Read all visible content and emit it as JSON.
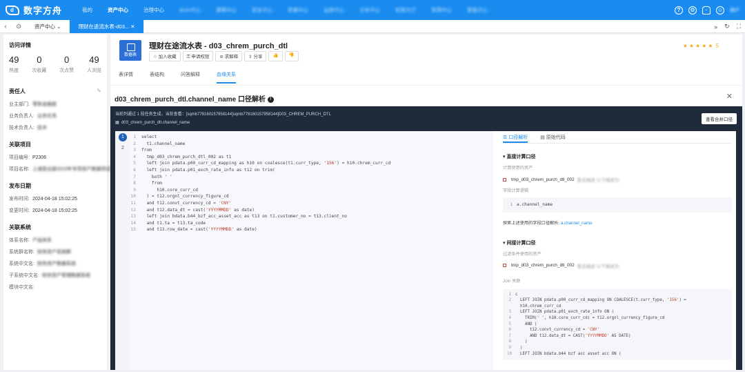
{
  "topnav": {
    "brand": "数字方舟",
    "items": [
      "我的",
      "资产中心",
      "治理中心",
      "BI/AI中心",
      "建模中心",
      "研发中心",
      "质量中心",
      "运维中心",
      "分析中心",
      "权限大厅",
      "管理中心",
      "智能中心"
    ],
    "active_index": 1,
    "icons": [
      "help-icon",
      "settings-icon",
      "bell-icon",
      "user-icon"
    ],
    "user": "用户"
  },
  "tabbar": {
    "tabs": [
      "资产中心",
      "理财在途流水表-d03..."
    ],
    "active_index": 1
  },
  "visit": {
    "title": "访问详情",
    "stats": [
      {
        "value": "49",
        "label": "热度"
      },
      {
        "value": "0",
        "label": "次收藏"
      },
      {
        "value": "0",
        "label": "次点赞"
      },
      {
        "value": "49",
        "label": "人浏览"
      }
    ]
  },
  "owner": {
    "title": "责任人",
    "rows": [
      {
        "label": "业主部门:",
        "value": "零售金融部"
      },
      {
        "label": "业务负责人:",
        "value": "业务负责"
      },
      {
        "label": "技术负责人:",
        "value": "技术"
      }
    ]
  },
  "project": {
    "title": "关联项目",
    "rows": [
      {
        "label": "项目编号:",
        "value": "P2306"
      },
      {
        "label": "项目名称:",
        "value": "上海营业部2023年专项资产数据项目"
      }
    ]
  },
  "publish": {
    "title": "发布日期",
    "rows": [
      {
        "label": "发布时间:",
        "value": "2024-04-18 15:02:25"
      },
      {
        "label": "变更时间:",
        "value": "2024-04-18 15:02:25"
      }
    ]
  },
  "system": {
    "title": "关联系统",
    "rows": [
      {
        "label": "体系名称:",
        "value": "产品体系"
      },
      {
        "label": "系统群名称:",
        "value": "财务资产系统群"
      },
      {
        "label": "系统中文名:",
        "value": "财务资产数据系统"
      },
      {
        "label": "子系统中文名:",
        "value": "财务资产管理数据系统"
      },
      {
        "label": "模块中文名:",
        "value": ""
      }
    ]
  },
  "asset": {
    "icon_label": "数据表",
    "title": "理财在途流水表 - d03_chrem_purch_dtl",
    "actions": [
      "加入收藏",
      "申请权限",
      "求解释",
      "分享",
      "",
      ""
    ],
    "rating": "5",
    "tabs": [
      "表详情",
      "表结构",
      "问答解释",
      "血缘关系"
    ],
    "active_tab": 3
  },
  "panel": {
    "title": "d03_chrem_purch_dtl.channel_name 口径解析",
    "header_line1": "当前列通过 1 段任务生成，当前查看：[sqmb778160157958144]sqmb778160157958144]D03_CHREM_PURCH_DTL",
    "header_line2": "d03_chrem_purch_dtl.channel_name",
    "merge_button": "查看合并口径"
  },
  "gutter": [
    "1",
    "2"
  ],
  "code_lines": [
    {
      "n": "1",
      "t": "select"
    },
    {
      "n": "2",
      "t": "  t1.channel_name"
    },
    {
      "n": "3",
      "t": "from"
    },
    {
      "n": "4",
      "t": "  tmp_d03_chrem_purch_dtl_002 as t1"
    },
    {
      "n": "5",
      "t": "  left join pdata.p00_curr_cd_mapping as h10 on coalesce(t1.curr_type, '156') = h10.chrem_curr_cd"
    },
    {
      "n": "6",
      "t": "  left join pdata.p01_exch_rate_info as t12 on trim("
    },
    {
      "n": "7",
      "t": "    both ' '"
    },
    {
      "n": "8",
      "t": "    from"
    },
    {
      "n": "9",
      "t": "      h10.core_curr_cd"
    },
    {
      "n": "10",
      "t": "  ) = t12.orgnl_currency_figure_cd"
    },
    {
      "n": "11",
      "t": "  and t12.convt_currency_cd = 'CNY'"
    },
    {
      "n": "12",
      "t": "  and t12.data_dt = cast('YYYYMMDD' as date)"
    },
    {
      "n": "13",
      "t": "  left join bdata.b44_bzf_acc_asset_acc as t13 on t1.customer_no = t13.client_no"
    },
    {
      "n": "14",
      "t": "  and t1.ta = t13.ta_code"
    },
    {
      "n": "15",
      "t": "  and t13.row_date = cast('YYYYMMDD' as date)"
    }
  ],
  "right": {
    "tabs": [
      "口径解析",
      "原始代码"
    ],
    "active_tab": 0,
    "direct": {
      "title": "直接计算口径",
      "sub": "计算使用的资产",
      "item": "tmp_d03_chrem_purch_dtl_002",
      "item_note": "暂无描述  以下描述为:",
      "logic_label": "字段计算逻辑",
      "logic_code": [
        {
          "n": "1",
          "t": "a.channel_name"
        }
      ],
      "explore_text": "探索上述使用的字段口径解析:",
      "explore_link": "a.channel_name"
    },
    "indirect": {
      "title": "间接计算口径",
      "sub": "过滤条件使用的资产",
      "item": "tmp_d03_chrem_purch_dtl_002",
      "item_note": "暂无描述  以下描述为:",
      "join_label": "Join 关联",
      "join_code": [
        {
          "n": "1",
          "t": "c"
        },
        {
          "n": "2",
          "t": "  LEFT JOIN pdata.p00_curr_cd_mapping ON COALESCE(t.curr_type, '156') ="
        },
        {
          "n": "",
          "t": "  h10.chrem_curr_cd"
        },
        {
          "n": "3",
          "t": "  LEFT JOIN pdata.p01_exch_rate_info ON ("
        },
        {
          "n": "4",
          "t": "    TRIM(' ', h10.core_curr_cd) = t12.orgnl_currency_figure_cd"
        },
        {
          "n": "5",
          "t": "    AND ("
        },
        {
          "n": "6",
          "t": "      t12.convt_currency_cd = 'CNY'"
        },
        {
          "n": "7",
          "t": "      AND t12.data_dt = CAST('YYYYMMDD' AS DATE)"
        },
        {
          "n": "8",
          "t": "    )"
        },
        {
          "n": "9",
          "t": "  )"
        },
        {
          "n": "10",
          "t": "  LEFT JOIN bdata.b44 bzf acc asset acc ON ("
        }
      ]
    }
  }
}
